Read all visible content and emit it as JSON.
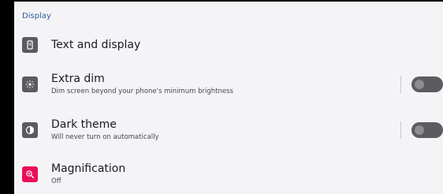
{
  "section": {
    "title": "Display"
  },
  "items": [
    {
      "title": "Text and display",
      "summary": "",
      "icon": "text-display-icon",
      "icon_bg": "#5b5b5f"
    },
    {
      "title": "Extra dim",
      "summary": "Dim screen beyond your phone's minimum brightness",
      "icon": "extra-dim-icon",
      "icon_bg": "#5b5b5f",
      "toggle": "off"
    },
    {
      "title": "Dark theme",
      "summary": "Will never turn on automatically",
      "icon": "dark-theme-icon",
      "icon_bg": "#5b5b5f",
      "toggle": "off"
    },
    {
      "title": "Magnification",
      "summary": "Off",
      "icon": "magnification-icon",
      "icon_bg": "#ec0d58"
    }
  ],
  "colors": {
    "background": "#f4f4f7",
    "accent": "#335c99",
    "toggle_off_track": "#5c5c60",
    "magnification_icon": "#ec0d58"
  }
}
